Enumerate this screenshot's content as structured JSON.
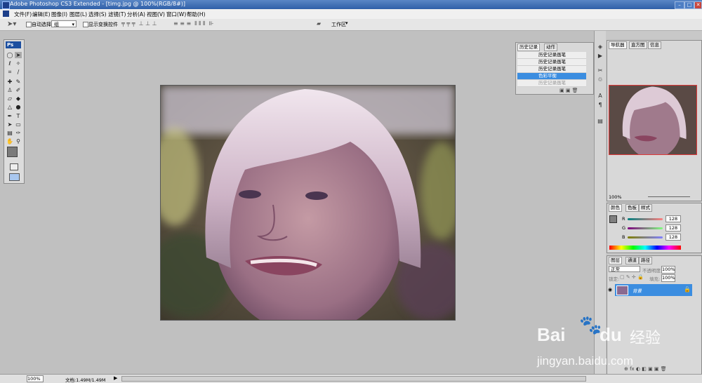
{
  "window": {
    "title": "Adobe Photoshop CS3 Extended - [timg.jpg @ 100%(RGB/8#)]",
    "min": "–",
    "max": "□",
    "close": "✕"
  },
  "menu": [
    "文件(F)",
    "编辑(E)",
    "图像(I)",
    "图层(L)",
    "选择(S)",
    "滤镜(T)",
    "分析(A)",
    "视图(V)",
    "窗口(W)",
    "帮助(H)"
  ],
  "options": {
    "auto_select": "自动选择:",
    "auto_select_value": "组",
    "show_transform": "显示变换控件",
    "workspace": "工作区"
  },
  "toolbox": {
    "logo": "Ps"
  },
  "history": {
    "tabs": [
      "历史记录",
      "动作"
    ],
    "items": [
      {
        "label": "历史记录画笔",
        "selected": false
      },
      {
        "label": "历史记录画笔",
        "selected": false
      },
      {
        "label": "历史记录画笔",
        "selected": false
      },
      {
        "label": "色彩平衡",
        "selected": true
      },
      {
        "label": "历史记录画笔",
        "selected": false
      }
    ]
  },
  "navigator": {
    "tabs": [
      "导航器",
      "直方图",
      "信息"
    ],
    "zoom": "100%"
  },
  "color": {
    "tabs": [
      "颜色",
      "色板",
      "样式"
    ],
    "r_label": "R",
    "g_label": "G",
    "b_label": "B",
    "r": "128",
    "g": "128",
    "b": "128"
  },
  "layers": {
    "tabs": [
      "图层",
      "通道",
      "路径"
    ],
    "blend": "正常",
    "opacity_label": "不透明度:",
    "opacity": "100%",
    "lock_label": "锁定:",
    "fill_label": "填充:",
    "fill": "100%",
    "layer_name": "背景"
  },
  "status": {
    "zoom": "100%",
    "doc": "文档:1.49M/1.49M"
  },
  "watermark": {
    "brand": "Bai",
    "brand2": "du",
    "cn": "经验",
    "url": "jingyan.baidu.com"
  },
  "colors": {
    "selection": "#3b8de0",
    "titlebar": "#2f5fa8",
    "layer_highlight": "#3b8de0"
  }
}
